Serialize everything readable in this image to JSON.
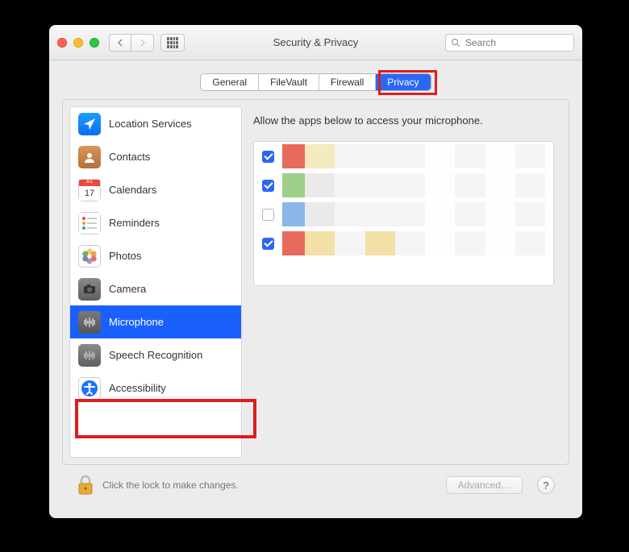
{
  "window": {
    "title": "Security & Privacy",
    "search_placeholder": "Search"
  },
  "tabs": [
    {
      "id": "general",
      "label": "General",
      "active": false
    },
    {
      "id": "filevault",
      "label": "FileVault",
      "active": false
    },
    {
      "id": "firewall",
      "label": "Firewall",
      "active": false
    },
    {
      "id": "privacy",
      "label": "Privacy",
      "active": true
    }
  ],
  "sidebar": {
    "items": [
      {
        "id": "location",
        "label": "Location Services",
        "icon": "location-icon",
        "selected": false
      },
      {
        "id": "contacts",
        "label": "Contacts",
        "icon": "contacts-icon",
        "selected": false
      },
      {
        "id": "calendars",
        "label": "Calendars",
        "icon": "calendar-icon",
        "selected": false
      },
      {
        "id": "reminders",
        "label": "Reminders",
        "icon": "reminders-icon",
        "selected": false
      },
      {
        "id": "photos",
        "label": "Photos",
        "icon": "photos-icon",
        "selected": false
      },
      {
        "id": "camera",
        "label": "Camera",
        "icon": "camera-icon",
        "selected": false
      },
      {
        "id": "microphone",
        "label": "Microphone",
        "icon": "microphone-icon",
        "selected": true
      },
      {
        "id": "speech",
        "label": "Speech Recognition",
        "icon": "speech-icon",
        "selected": false
      },
      {
        "id": "accessibility",
        "label": "Accessibility",
        "icon": "accessibility-icon",
        "selected": false
      }
    ]
  },
  "content": {
    "header": "Allow the apps below to access your microphone.",
    "apps": [
      {
        "checked": true,
        "mosaic": [
          "#e76a5d",
          "#f5e9c0",
          "#f5f5f5",
          "#f5f5f5",
          "#f5f5f5",
          "#fefefe",
          "#f5f5f5",
          "#fefefe",
          "#f5f5f5"
        ]
      },
      {
        "checked": true,
        "mosaic": [
          "#9dcf8a",
          "#eaeaea",
          "#f5f5f5",
          "#f5f5f5",
          "#f5f5f5",
          "#fefefe",
          "#f5f5f5",
          "#fefefe",
          "#f5f5f5"
        ]
      },
      {
        "checked": false,
        "mosaic": [
          "#8ab7ea",
          "#eaeaea",
          "#f5f5f5",
          "#f5f5f5",
          "#f5f5f5",
          "#fefefe",
          "#f5f5f5",
          "#fefefe",
          "#f5f5f5"
        ]
      },
      {
        "checked": true,
        "mosaic": [
          "#e76a5d",
          "#f2e0a6",
          "#f5f5f5",
          "#f2e0a6",
          "#f5f5f5",
          "#fefefe",
          "#f5f5f5",
          "#fefefe",
          "#f5f5f5"
        ]
      }
    ]
  },
  "footer": {
    "lock_text": "Click the lock to make changes.",
    "advanced_label": "Advanced…",
    "help_label": "?"
  },
  "highlights": {
    "privacy_tab": true,
    "microphone_row": true
  }
}
